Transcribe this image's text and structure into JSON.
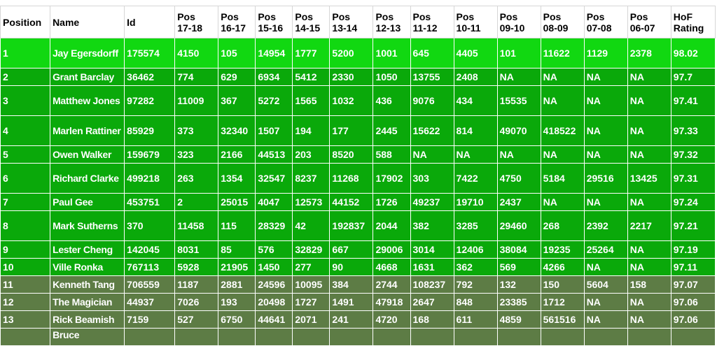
{
  "colors": {
    "row_bright_green": "#11d811",
    "row_medium_green": "#0aa90a",
    "row_olive_green": "#5d7c45",
    "header_background": "#ffffff"
  },
  "table": {
    "headers": [
      "Position",
      "Name",
      "Id",
      "Pos\n17-18",
      "Pos\n16-17",
      "Pos\n15-16",
      "Pos\n14-15",
      "Pos\n13-14",
      "Pos\n12-13",
      "Pos\n11-12",
      "Pos\n10-11",
      "Pos\n09-10",
      "Pos\n08-09",
      "Pos\n07-08",
      "Pos\n06-07",
      "HoF\nRating"
    ],
    "rows": [
      [
        "1",
        "Jay Egersdorff",
        "175574",
        "4150",
        "105",
        "14954",
        "1777",
        "5200",
        "1001",
        "645",
        "4405",
        "101",
        "11622",
        "1129",
        "2378",
        "98.02"
      ],
      [
        "2",
        "Grant Barclay",
        "36462",
        "774",
        "629",
        "6934",
        "5412",
        "2330",
        "1050",
        "13755",
        "2408",
        "NA",
        "NA",
        "NA",
        "NA",
        "97.7"
      ],
      [
        "3",
        "Matthew Jones",
        "97282",
        "11009",
        "367",
        "5272",
        "1565",
        "1032",
        "436",
        "9076",
        "434",
        "15535",
        "NA",
        "NA",
        "NA",
        "97.41"
      ],
      [
        "4",
        "Marlen Rattiner",
        "85929",
        "373",
        "32340",
        "1507",
        "194",
        "177",
        "2445",
        "15622",
        "814",
        "49070",
        "418522",
        "NA",
        "NA",
        "97.33"
      ],
      [
        "5",
        "Owen Walker",
        "159679",
        "323",
        "2166",
        "44513",
        "203",
        "8520",
        "588",
        "NA",
        "NA",
        "NA",
        "NA",
        "NA",
        "NA",
        "97.32"
      ],
      [
        "6",
        "Richard Clarke",
        "499218",
        "263",
        "1354",
        "32547",
        "8237",
        "11268",
        "17902",
        "303",
        "7422",
        "4750",
        "5184",
        "29516",
        "13425",
        "97.31"
      ],
      [
        "7",
        "Paul Gee",
        "453751",
        "2",
        "25015",
        "4047",
        "12573",
        "44152",
        "1726",
        "49237",
        "19710",
        "2437",
        "NA",
        "NA",
        "NA",
        "97.24"
      ],
      [
        "8",
        "Mark Sutherns",
        "370",
        "11458",
        "115",
        "28329",
        "42",
        "192837",
        "2044",
        "382",
        "3285",
        "29460",
        "268",
        "2392",
        "2217",
        "97.21"
      ],
      [
        "9",
        "Lester Cheng",
        "142045",
        "8031",
        "85",
        "576",
        "32829",
        "667",
        "29006",
        "3014",
        "12406",
        "38084",
        "19235",
        "25264",
        "NA",
        "97.19"
      ],
      [
        "10",
        "Ville Ronka",
        "767113",
        "5928",
        "21905",
        "1450",
        "277",
        "90",
        "4668",
        "1631",
        "362",
        "569",
        "4266",
        "NA",
        "NA",
        "97.11"
      ],
      [
        "11",
        "Kenneth Tang",
        "706559",
        "1187",
        "2881",
        "24596",
        "10095",
        "384",
        "2744",
        "108237",
        "792",
        "132",
        "150",
        "5604",
        "158",
        "97.07"
      ],
      [
        "12",
        "The Magician",
        "44937",
        "7026",
        "193",
        "20498",
        "1727",
        "1491",
        "47918",
        "2647",
        "848",
        "23385",
        "1712",
        "NA",
        "NA",
        "97.06"
      ],
      [
        "13",
        "Rick Beamish",
        "7159",
        "527",
        "6750",
        "44641",
        "2071",
        "241",
        "4720",
        "168",
        "611",
        "4859",
        "561516",
        "NA",
        "NA",
        "97.06"
      ],
      [
        "",
        "Bruce",
        "",
        "",
        "",
        "",
        "",
        "",
        "",
        "",
        "",
        "",
        "",
        "",
        "",
        ""
      ]
    ]
  }
}
